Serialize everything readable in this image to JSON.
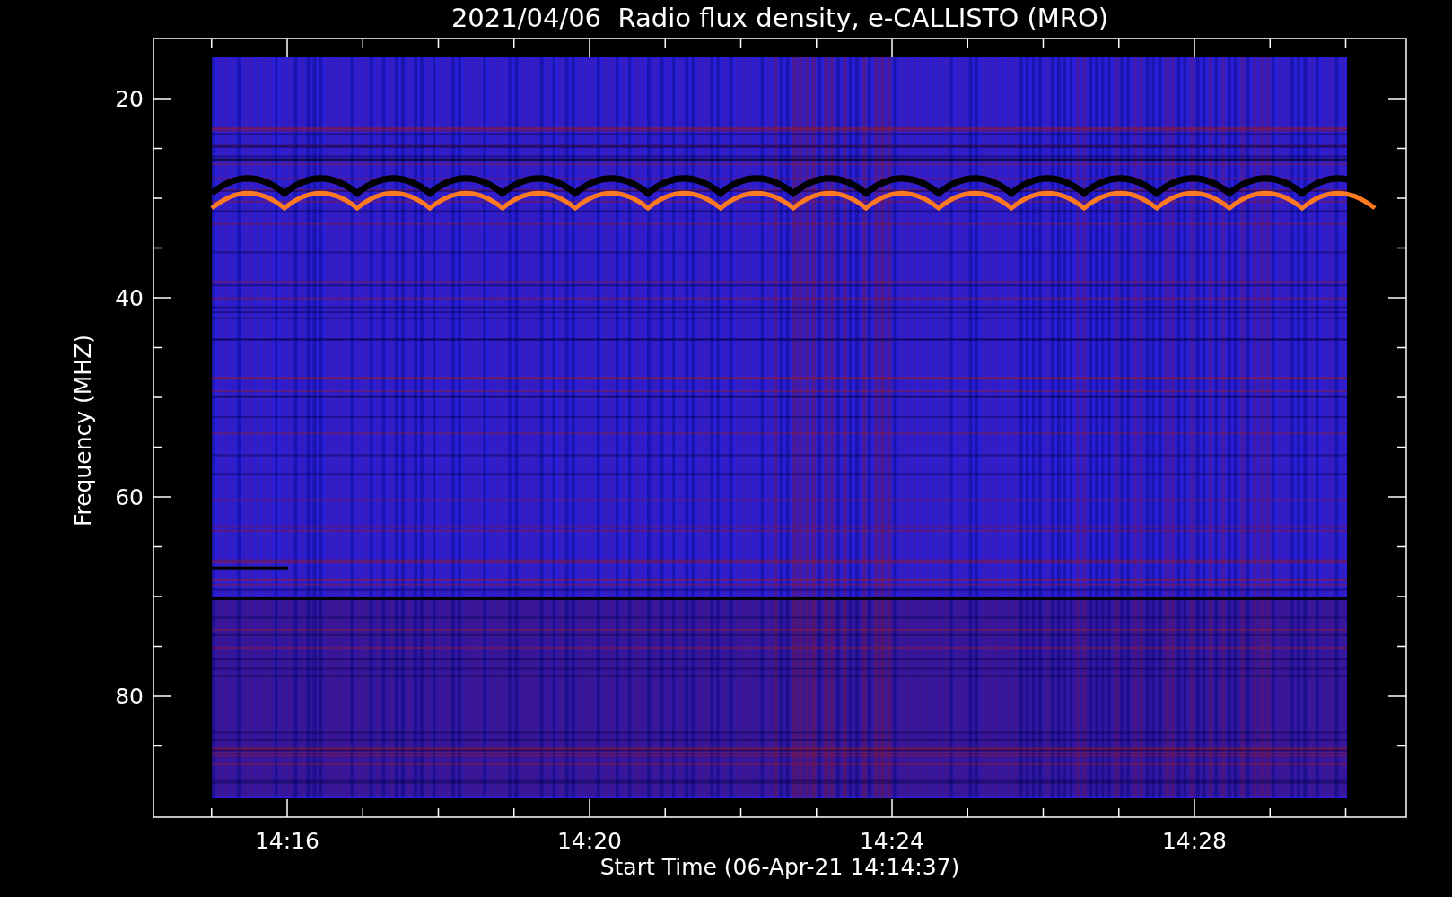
{
  "title": "2021/04/06  Radio flux density, e-CALLISTO (MRO)",
  "y_axis": {
    "label": "Frequency (MHZ)",
    "ticks": [
      "20",
      "40",
      "60",
      "80"
    ]
  },
  "x_axis": {
    "label": "Start Time (06-Apr-21 14:14:37)",
    "ticks": [
      "14:16",
      "14:20",
      "14:24",
      "14:28"
    ]
  }
}
